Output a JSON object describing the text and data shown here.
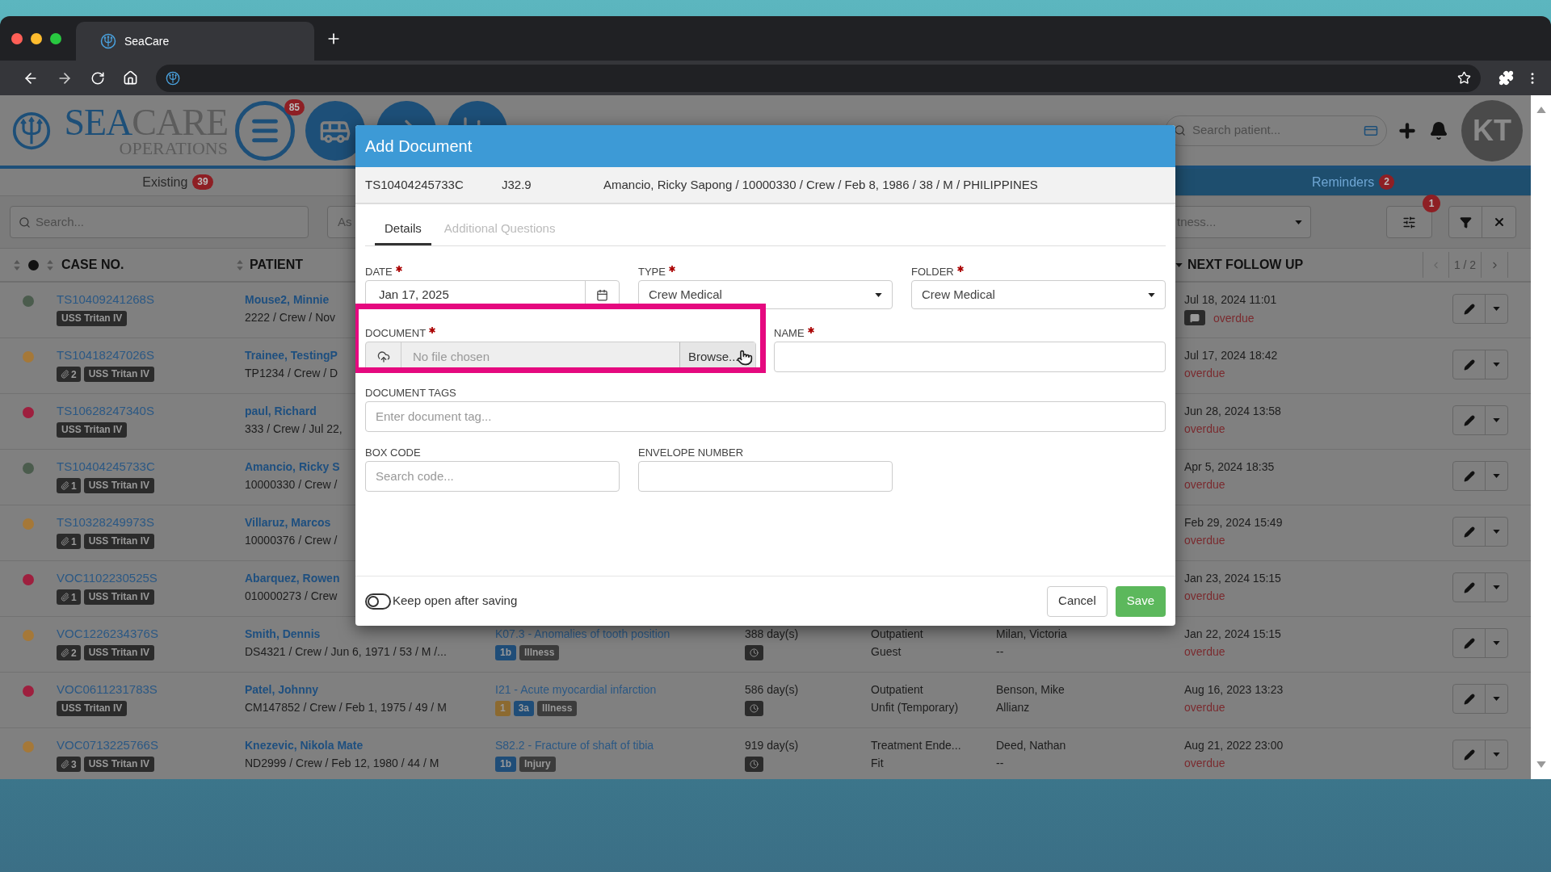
{
  "browser": {
    "tab_title": "SeaCare"
  },
  "header": {
    "logo_primary": "SEA",
    "logo_secondary": "CARE",
    "logo_subtitle": "OPERATIONS",
    "menu_badge": "85",
    "search": {
      "placeholder": "Search patient..."
    },
    "avatar": "KT"
  },
  "tabs": [
    {
      "label": "Existing",
      "count": "39",
      "selected": false
    },
    {
      "label": "Reminders",
      "count": "2",
      "selected": true
    }
  ],
  "toolbar": {
    "search_placeholder": "Search...",
    "field_2": "As",
    "field_3": "tness...",
    "filter_badge": "1"
  },
  "table": {
    "columns": [
      "CASE NO.",
      "PATIENT",
      "NEXT FOLLOW UP"
    ],
    "page": "1 / 2",
    "rows": [
      {
        "color": "#4b5c4d",
        "case_no": "TS10409241268S",
        "vessel": "USS Tritan IV",
        "patient": "Mouse2, Minnie",
        "patient_info": "2222 / Crew / Nov",
        "follow_up": "Jul 18, 2024 11:01",
        "comment": true,
        "due": "overdue"
      },
      {
        "color": "#a57838",
        "case_no": "TS10418247026S",
        "attachments": "2",
        "vessel": "USS Tritan IV",
        "patient": "Trainee, TestingP",
        "patient_info": "TP1234 / Crew / D",
        "follow_up": "Jul 17, 2024 18:42",
        "comment": false,
        "due": "overdue"
      },
      {
        "color": "#9e1f3e",
        "case_no": "TS10628247340S",
        "vessel": "USS Tritan IV",
        "patient": "paul, Richard",
        "patient_info": "333 / Crew / Jul 22,",
        "follow_up": "Jun 28, 2024 13:58",
        "comment": false,
        "due": "overdue"
      },
      {
        "color": "#4b5c4d",
        "case_no": "TS10404245733C",
        "attachments": "1",
        "vessel": "USS Tritan IV",
        "patient": "Amancio, Ricky S",
        "patient_info": "10000330 / Crew /",
        "follow_up": "Apr 5, 2024 18:35",
        "comment": false,
        "due": "overdue"
      },
      {
        "color": "#a57838",
        "case_no": "TS10328249973S",
        "attachments": "1",
        "vessel": "USS Tritan IV",
        "patient": "Villaruz, Marcos",
        "patient_info": "10000376 / Crew /",
        "follow_up": "Feb 29, 2024 15:49",
        "comment": false,
        "due": "overdue"
      },
      {
        "color": "#9e1f3e",
        "case_no": "VOC1102230525S",
        "attachments": "1",
        "vessel": "USS Tritan IV",
        "patient": "Abarquez, Rowen",
        "patient_info": "010000273 / Crew",
        "follow_up": "Jan 23, 2024 15:15",
        "comment": false,
        "due": "overdue"
      },
      {
        "color": "#a57838",
        "case_no": "VOC1226234376S",
        "attachments": "2",
        "vessel": "USS Tritan IV",
        "patient": "Smith, Dennis",
        "patient_info": "DS4321 / Crew / Jun 6, 1971 / 53 / M /...",
        "diagnosis": "K07.3 - Anomalies of tooth position",
        "diagnosis_tags": [
          {
            "label": "1b",
            "color": "#1f4d78"
          },
          {
            "label": "Illness",
            "color": "#3c3c3c"
          }
        ],
        "duration": "388 day(s)",
        "status": [
          "Outpatient",
          "Guest"
        ],
        "doctor": [
          "Milan, Victoria",
          "--"
        ],
        "follow_up": "Jan 22, 2024 15:15",
        "comment": false,
        "due": "overdue"
      },
      {
        "color": "#9e1f3e",
        "case_no": "VOC0611231783S",
        "vessel": "USS Tritan IV",
        "patient": "Patel, Johnny",
        "patient_info": "CM147852 / Crew / Feb 1, 1975 / 49 / M",
        "diagnosis": "I21 - Acute myocardial infarction",
        "diagnosis_tags": [
          {
            "label": "1",
            "color": "#8c6a30"
          },
          {
            "label": "3a",
            "color": "#1f4d78"
          },
          {
            "label": "Illness",
            "color": "#3c3c3c"
          }
        ],
        "duration": "586 day(s)",
        "status": [
          "Outpatient",
          "Unfit (Temporary)"
        ],
        "doctor": [
          "Benson, Mike",
          "Allianz"
        ],
        "follow_up": "Aug 16, 2023 13:23",
        "comment": false,
        "due": "overdue"
      },
      {
        "color": "#a57838",
        "case_no": "VOC0713225766S",
        "attachments": "3",
        "vessel": "USS Tritan IV",
        "patient": "Knezevic, Nikola Mate",
        "patient_info": "ND2999 / Crew / Feb 12, 1980 / 44 / M",
        "diagnosis": "S82.2 - Fracture of shaft of tibia",
        "diagnosis_tags": [
          {
            "label": "1b",
            "color": "#1f4d78"
          },
          {
            "label": "Injury",
            "color": "#3c3c3c"
          }
        ],
        "duration": "919 day(s)",
        "status": [
          "Treatment Ende...",
          "Fit"
        ],
        "doctor": [
          "Deed, Nathan",
          "--"
        ],
        "follow_up": "Aug 21, 2022 23:00",
        "comment": false,
        "due": "overdue"
      }
    ]
  },
  "modal": {
    "title": "Add Document",
    "case_no": "TS10404245733C",
    "diagnosis_code": "J32.9",
    "patient_summary": "Amancio, Ricky Sapong / 10000330 / Crew / Feb 8, 1986 / 38 / M / PHILIPPINES",
    "tabs": [
      {
        "label": "Details",
        "selected": true
      },
      {
        "label": "Additional Questions",
        "selected": false
      }
    ],
    "date": {
      "label": "DATE",
      "required": true,
      "value": "Jan 17, 2025"
    },
    "type": {
      "label": "TYPE",
      "required": true,
      "value": "Crew Medical"
    },
    "folder": {
      "label": "FOLDER",
      "required": true,
      "value": "Crew Medical"
    },
    "document": {
      "label": "DOCUMENT",
      "required": true,
      "placeholder": "No file chosen",
      "button": "Browse...",
      "highlighted": true
    },
    "name": {
      "label": "NAME",
      "required": true
    },
    "tags": {
      "label": "DOCUMENT TAGS",
      "required": false,
      "placeholder": "Enter document tag..."
    },
    "box_code": {
      "label": "BOX CODE",
      "required": false,
      "placeholder": "Search code..."
    },
    "envelope": {
      "label": "ENVELOPE NUMBER",
      "required": false
    },
    "keep_open": {
      "label": "Keep open after saving",
      "on": false
    },
    "buttons": {
      "cancel": "Cancel",
      "save": "Save"
    }
  }
}
